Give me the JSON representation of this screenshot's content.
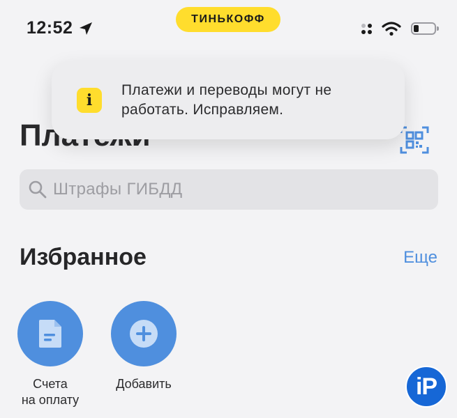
{
  "status_bar": {
    "time": "12:52",
    "battery_level": 0.25,
    "icons": [
      "location-arrow-icon",
      "cellular-icon",
      "wifi-icon",
      "battery-icon"
    ]
  },
  "brand": {
    "text": "ТИНЬКОФФ",
    "color": "#ffdd2d"
  },
  "toast": {
    "icon": "info-icon",
    "icon_glyph": "i",
    "line1": "Платежи и переводы могут не",
    "line2": "работать. Исправляем."
  },
  "header": {
    "title": "Платежи",
    "qr_icon": "qr-code-scan-icon"
  },
  "search": {
    "placeholder": "Штрафы ГИБДД",
    "icon": "search-icon"
  },
  "favorites": {
    "title": "Избранное",
    "more_label": "Еще",
    "items": [
      {
        "line1": "Счета",
        "line2": "на оплату",
        "icon": "document-icon"
      },
      {
        "line1": "Добавить",
        "line2": "",
        "icon": "plus-icon"
      }
    ]
  },
  "watermark": {
    "text": "iP"
  },
  "colors": {
    "accent": "#4f8fde",
    "brand_yellow": "#ffdd2d",
    "background": "#f3f3f5"
  }
}
